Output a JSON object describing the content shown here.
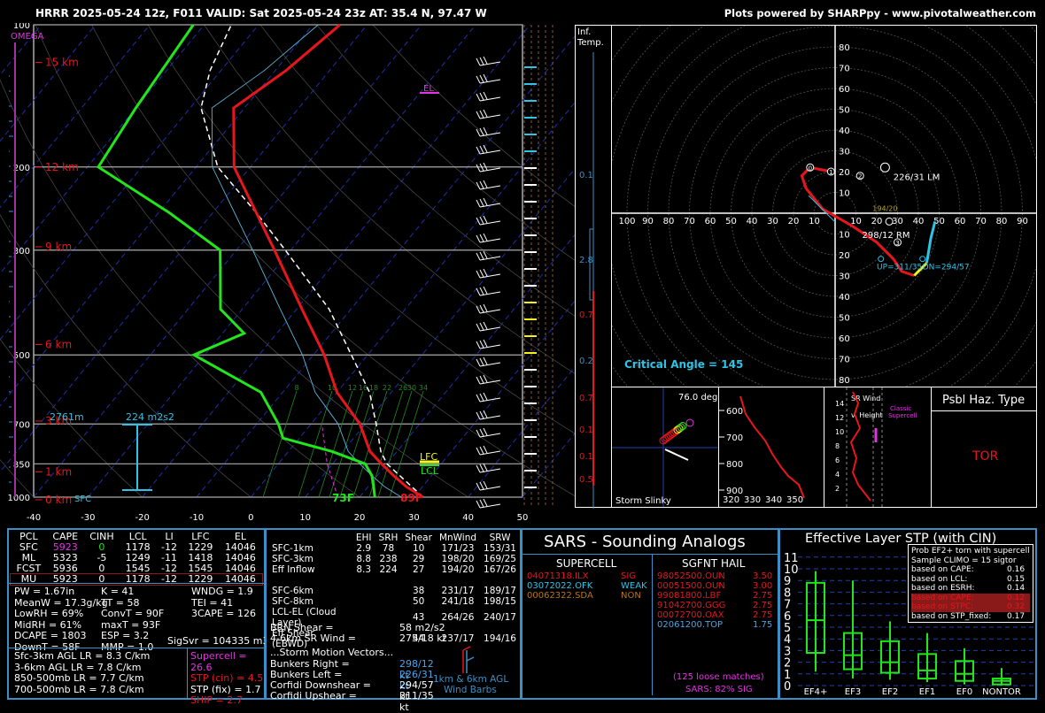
{
  "header": {
    "left": "HRRR 2025-05-24 12z, F011  VALID: Sat 2025-05-24 23z  AT: 35.4 N, 97.47 W",
    "right": "Plots powered by SHARPpy - www.pivotalweather.com"
  },
  "colors": {
    "temp": "#e8161c",
    "dewp": "#22e51c",
    "box": "#3a8fc6",
    "cyan": "#2fc3e6",
    "magenta": "#e234e2",
    "yellow": "#f4f41a"
  },
  "skewt": {
    "omega_label": "OMEGA",
    "el_label": "EL",
    "lfc_label": "LFC",
    "lcl_label": "LCL",
    "sfc_label": "SFC",
    "pressure_levels": [
      100,
      200,
      300,
      500,
      700,
      850,
      1000
    ],
    "height_labels": [
      "15 km",
      "12 km",
      "9 km",
      "6 km",
      "3 km",
      "1 km",
      "0 km"
    ],
    "x_ticks": [
      "-40",
      "-30",
      "-20",
      "-10",
      "0",
      "10",
      "20",
      "30",
      "40",
      "50"
    ],
    "mixing_ratio_labels": [
      "8",
      "10",
      "12",
      "16",
      "18",
      "22",
      "26",
      "30",
      "34"
    ],
    "sfc_temp": "89F",
    "sfc_dewp": "73F",
    "eff_inflow_top": "2761m",
    "eff_srh": "224 m2s2",
    "temp_profile": [
      [
        1000,
        31.7
      ],
      [
        950,
        27
      ],
      [
        900,
        23
      ],
      [
        850,
        19
      ],
      [
        800,
        15
      ],
      [
        700,
        9
      ],
      [
        600,
        0
      ],
      [
        500,
        -8
      ],
      [
        400,
        -19
      ],
      [
        300,
        -33
      ],
      [
        250,
        -42
      ],
      [
        200,
        -53
      ],
      [
        150,
        -62
      ],
      [
        125,
        -58
      ],
      [
        100,
        -55
      ]
    ],
    "dewp_profile": [
      [
        1000,
        22.8
      ],
      [
        950,
        21
      ],
      [
        900,
        19
      ],
      [
        850,
        16
      ],
      [
        800,
        8
      ],
      [
        750,
        -3
      ],
      [
        700,
        -6
      ],
      [
        600,
        -14
      ],
      [
        500,
        -32
      ],
      [
        450,
        -26
      ],
      [
        400,
        -34
      ],
      [
        330,
        -40
      ],
      [
        300,
        -43
      ],
      [
        250,
        -58
      ],
      [
        200,
        -78
      ],
      [
        150,
        -80
      ],
      [
        100,
        -82
      ]
    ]
  },
  "inf_temp_label": [
    "Inf.",
    "Temp."
  ],
  "inf_values": [
    "0.1",
    "2.8",
    "0.7",
    "0.2",
    "0.7",
    "0.1",
    "0.1",
    "0.5"
  ],
  "hodograph": {
    "rings": [
      "10",
      "20",
      "30",
      "40",
      "50",
      "60",
      "70",
      "80"
    ],
    "x_ticks": [
      "100",
      "90",
      "80",
      "70",
      "60",
      "50",
      "40",
      "30",
      "20",
      "10",
      "10",
      "20",
      "30",
      "40",
      "50",
      "60",
      "70",
      "80",
      "90",
      "1"
    ],
    "lm_label": "226/31 LM",
    "rm_label": "298/12 RM",
    "mean_label": "194/20",
    "up_label": "UP=311/35",
    "dn_label": "DN=294/57",
    "critical_angle": "Critical Angle = 145",
    "points": [
      "0",
      "1",
      "2",
      "3"
    ]
  },
  "slinky": {
    "deg": "76.0 deg",
    "label": "Storm Slinky"
  },
  "theta": {
    "y_ticks": [
      "600",
      "700",
      "800",
      "900"
    ],
    "x_ticks": [
      "320",
      "330",
      "340",
      "350"
    ]
  },
  "srwind": {
    "title": "SR Wind v. Height",
    "legend": "Classic Supercell",
    "y_ticks": [
      "14",
      "12",
      "10",
      "8",
      "6",
      "4",
      "2"
    ]
  },
  "hazard": {
    "title": "Psbl Haz. Type",
    "value": "TOR"
  },
  "parcels": {
    "headers": [
      "PCL",
      "CAPE",
      "CINH",
      "LCL",
      "LI",
      "LFC",
      "EL"
    ],
    "rows": [
      [
        "SFC",
        "5923",
        "0",
        "1178",
        "-12",
        "1229",
        "14046"
      ],
      [
        "ML",
        "5323",
        "-5",
        "1249",
        "-11",
        "1418",
        "14046"
      ],
      [
        "FCST",
        "5936",
        "0",
        "1545",
        "-12",
        "1545",
        "14046"
      ],
      [
        "MU",
        "5923",
        "0",
        "1178",
        "-12",
        "1229",
        "14046"
      ]
    ]
  },
  "indices": {
    "col1": [
      "PW = 1.67in",
      "MeanW = 17.3g/kg",
      "LowRH = 69%",
      "MidRH = 61%",
      "DCAPE = 1803",
      "DownT = 58F"
    ],
    "col2": [
      "K = 41",
      "TT = 58",
      "ConvT = 90F",
      "maxT = 93F",
      "ESP = 3.2",
      "MMP = 1.0"
    ],
    "col3": [
      "WNDG = 1.9",
      "TEI = 41",
      "3CAPE = 126",
      "",
      "",
      ""
    ],
    "sigsvr": "SigSvr = 104335 m3/s3",
    "lapse": [
      "Sfc-3km AGL LR = 8.3 C/km",
      "3-6km AGL LR = 7.8 C/km",
      "850-500mb LR = 7.7 C/km",
      "700-500mb LR = 7.8 C/km"
    ],
    "composites": [
      "Supercell = 26.6",
      "STP (cin) = 4.5",
      "STP (fix) = 1.7",
      "SHIP = 2.7"
    ]
  },
  "kinematics": {
    "headers": [
      "",
      "EHI",
      "SRH",
      "Shear",
      "MnWind",
      "SRW"
    ],
    "rows": [
      [
        "SFC-1km",
        "2.9",
        "78",
        "10",
        "171/23",
        "153/31"
      ],
      [
        "SFC-3km",
        "8.8",
        "238",
        "29",
        "198/20",
        "169/25"
      ],
      [
        "Eff Inflow",
        "8.3",
        "224",
        "27",
        "194/20",
        "167/26"
      ],
      [
        "",
        "",
        "",
        "",
        "",
        ""
      ],
      [
        "SFC-6km",
        "",
        "",
        "38",
        "231/17",
        "189/17"
      ],
      [
        "SFC-8km",
        "",
        "",
        "50",
        "241/18",
        "198/15"
      ],
      [
        "LCL-EL (Cloud Layer)",
        "",
        "",
        "43",
        "264/26",
        "240/17"
      ],
      [
        "Eff Shear (EBWD)",
        "",
        "",
        "44",
        "237/17",
        "194/16"
      ]
    ],
    "brn_label": "BRN Shear =",
    "brn_value": "58 m2/s2",
    "srw_label": "4-6km SR Wind =",
    "srw_value": "275/18 kt",
    "vectors_title": "...Storm Motion Vectors...",
    "vectors": [
      [
        "Bunkers Right =",
        "298/12 kt"
      ],
      [
        "Bunkers Left =",
        "226/31 kt"
      ],
      [
        "Corfidi Downshear =",
        "294/57 kt"
      ],
      [
        "Corfidi Upshear =",
        "311/35 kt"
      ]
    ],
    "barbs_label": [
      "1km & 6km AGL",
      "Wind Barbs"
    ]
  },
  "sars": {
    "title": "SARS - Sounding Analogs",
    "supercell_title": "SUPERCELL",
    "hail_title": "SGFNT HAIL",
    "supercell": [
      [
        "04071318.ILX",
        "SIG",
        "#e8161c"
      ],
      [
        "03072022.OFK",
        "WEAK",
        "#2fc3e6"
      ],
      [
        "00062322.SDA",
        "NON",
        "#b8741a"
      ]
    ],
    "hail": [
      [
        "98052500.OUN",
        "3.50"
      ],
      [
        "00051500.OUN",
        "3.00"
      ],
      [
        "99081800.LBF",
        "2.75"
      ],
      [
        "91042700.GGG",
        "2.75"
      ],
      [
        "00072700.OAX",
        "2.75"
      ],
      [
        "02061200.TOP",
        "1.75"
      ]
    ],
    "footer1": "(125 loose matches)",
    "footer2": "SARS: 82% SIG"
  },
  "stp": {
    "title": "Effective Layer STP (with CIN)",
    "y_ticks": [
      "11",
      "10",
      "9",
      "8",
      "7",
      "6",
      "5",
      "4",
      "3",
      "2",
      "1",
      "0"
    ],
    "categories": [
      "EF4+",
      "EF3",
      "EF2",
      "EF1",
      "EF0",
      "NONTOR"
    ],
    "legend": [
      [
        "Prob EF2+ torn with supercell",
        ""
      ],
      [
        "Sample CLIMO = 15 sigtor",
        ""
      ],
      [
        "based on CAPE:",
        "0.16"
      ],
      [
        "based on LCL:",
        "0.15"
      ],
      [
        "based on ESRH:",
        "0.14"
      ],
      [
        "based on CAPE:",
        "0.12"
      ],
      [
        "based on STPC:",
        "0.32"
      ],
      [
        "based on STP_fixed:",
        "0.17"
      ]
    ]
  },
  "chart_data": [
    {
      "type": "line",
      "title": "",
      "xlabel": "",
      "ylabel": "",
      "series": [
        {
          "x": [
            31.7,
            27,
            23,
            19,
            15,
            9,
            0,
            -8,
            -19,
            -33,
            -42,
            -53,
            -62,
            -58,
            -55
          ],
          "y": [
            1000,
            950,
            900,
            850,
            800,
            700,
            600,
            500,
            400,
            300,
            250,
            200,
            150,
            125,
            100
          ]
        },
        {
          "x": [
            22.8,
            21,
            19,
            16,
            8,
            -3,
            -6,
            -14,
            -32,
            -26,
            -34,
            -40,
            -43,
            -58,
            -78,
            -80,
            -82
          ],
          "y": [
            1000,
            950,
            900,
            850,
            800,
            750,
            700,
            600,
            500,
            450,
            400,
            330,
            300,
            250,
            200,
            150,
            100
          ]
        }
      ],
      "xlim": [
        -40,
        50
      ],
      "ylim": [
        1000,
        100
      ]
    },
    {
      "type": "bar",
      "title": "Effective Layer STP (with CIN)",
      "categories": [
        "EF4+",
        "EF3",
        "EF2",
        "EF1",
        "EF0",
        "NONTOR"
      ],
      "series": [
        {
          "values": [
            5.6,
            2.6,
            2.0,
            1.3,
            1.0,
            0.4
          ]
        }
      ],
      "ylim": [
        0,
        11
      ]
    }
  ]
}
